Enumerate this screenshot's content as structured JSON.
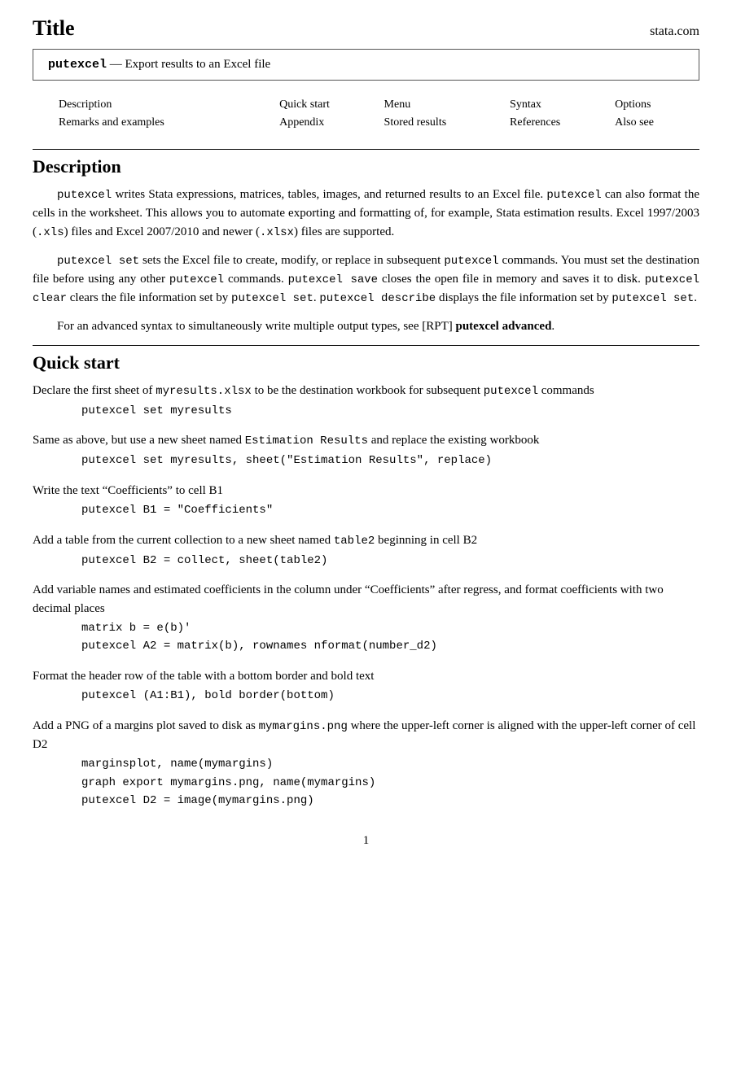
{
  "header": {
    "title": "Title",
    "brand": "stata.com"
  },
  "titleBox": {
    "command": "putexcel",
    "description": "— Export results to an Excel file"
  },
  "nav": {
    "rows": [
      [
        "Description",
        "Quick start",
        "Menu",
        "Syntax",
        "Options"
      ],
      [
        "Remarks and examples",
        "Appendix",
        "Stored results",
        "References",
        "Also see"
      ]
    ]
  },
  "descriptionSection": {
    "heading": "Description",
    "paragraphs": [
      "putexcel writes Stata expressions, matrices, tables, images, and returned results to an Excel file. putexcel can also format the cells in the worksheet. This allows you to automate exporting and formatting of, for example, Stata estimation results. Excel 1997/2003 (.xls) files and Excel 2007/2010 and newer (.xlsx) files are supported.",
      "putexcel set sets the Excel file to create, modify, or replace in subsequent putexcel commands. You must set the destination file before using any other putexcel commands. putexcel save closes the open file in memory and saves it to disk. putexcel clear clears the file information set by putexcel set. putexcel describe displays the file information set by putexcel set.",
      "For an advanced syntax to simultaneously write multiple output types, see [RPT] putexcel advanced."
    ]
  },
  "quickStartSection": {
    "heading": "Quick start",
    "items": [
      {
        "desc": "Declare the first sheet of myresults.xlsx to be the destination workbook for subsequent putexcel commands",
        "code": "putexcel set myresults"
      },
      {
        "desc": "Same as above, but use a new sheet named Estimation Results and replace the existing workbook",
        "code": "putexcel set myresults, sheet(\"Estimation Results\", replace)"
      },
      {
        "desc": "Write the text “Coefficients” to cell B1",
        "code": "putexcel B1 = \"Coefficients\""
      },
      {
        "desc": "Add a table from the current collection to a new sheet named table2 beginning in cell B2",
        "code": "putexcel B2 = collect, sheet(table2)"
      },
      {
        "desc": "Add variable names and estimated coefficients in the column under “Coefficients” after regress, and format coefficients with two decimal places",
        "code": "matrix b = e(b)'\nputexcel A2 = matrix(b), rownames nformat(number_d2)"
      },
      {
        "desc": "Format the header row of the table with a bottom border and bold text",
        "code": "putexcel (A1:B1), bold border(bottom)"
      },
      {
        "desc": "Add a PNG of a margins plot saved to disk as mymargins.png where the upper-left corner is aligned with the upper-left corner of cell D2",
        "code": "marginsplot, name(mymargins)\ngraph export mymargins.png, name(mymargins)\nputexcel D2 = image(mymargins.png)"
      }
    ]
  },
  "footer": {
    "page": "1"
  }
}
